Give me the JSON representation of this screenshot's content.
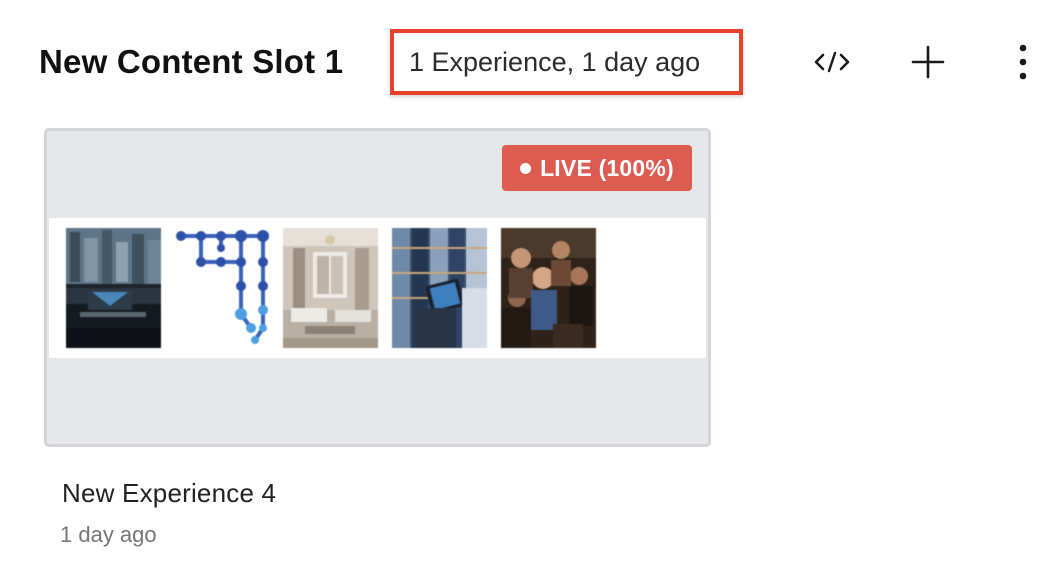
{
  "header": {
    "slot_title": "New Content Slot 1",
    "slot_meta": "1 Experience, 1 day ago",
    "highlight_color": "#e8412c"
  },
  "toolbar": {
    "code_icon": "code-icon",
    "add_icon": "plus-icon",
    "more_icon": "more-vertical-icon"
  },
  "experience_card": {
    "status_badge": "LIVE (100%)",
    "badge_color": "#dc5c52",
    "thumbnails": [
      "city-office-desk-image",
      "blue-dot-network-image",
      "living-room-interior-image",
      "warehouse-tablet-image",
      "crowd-people-image"
    ],
    "name": "New Experience 4",
    "time": "1 day ago"
  }
}
